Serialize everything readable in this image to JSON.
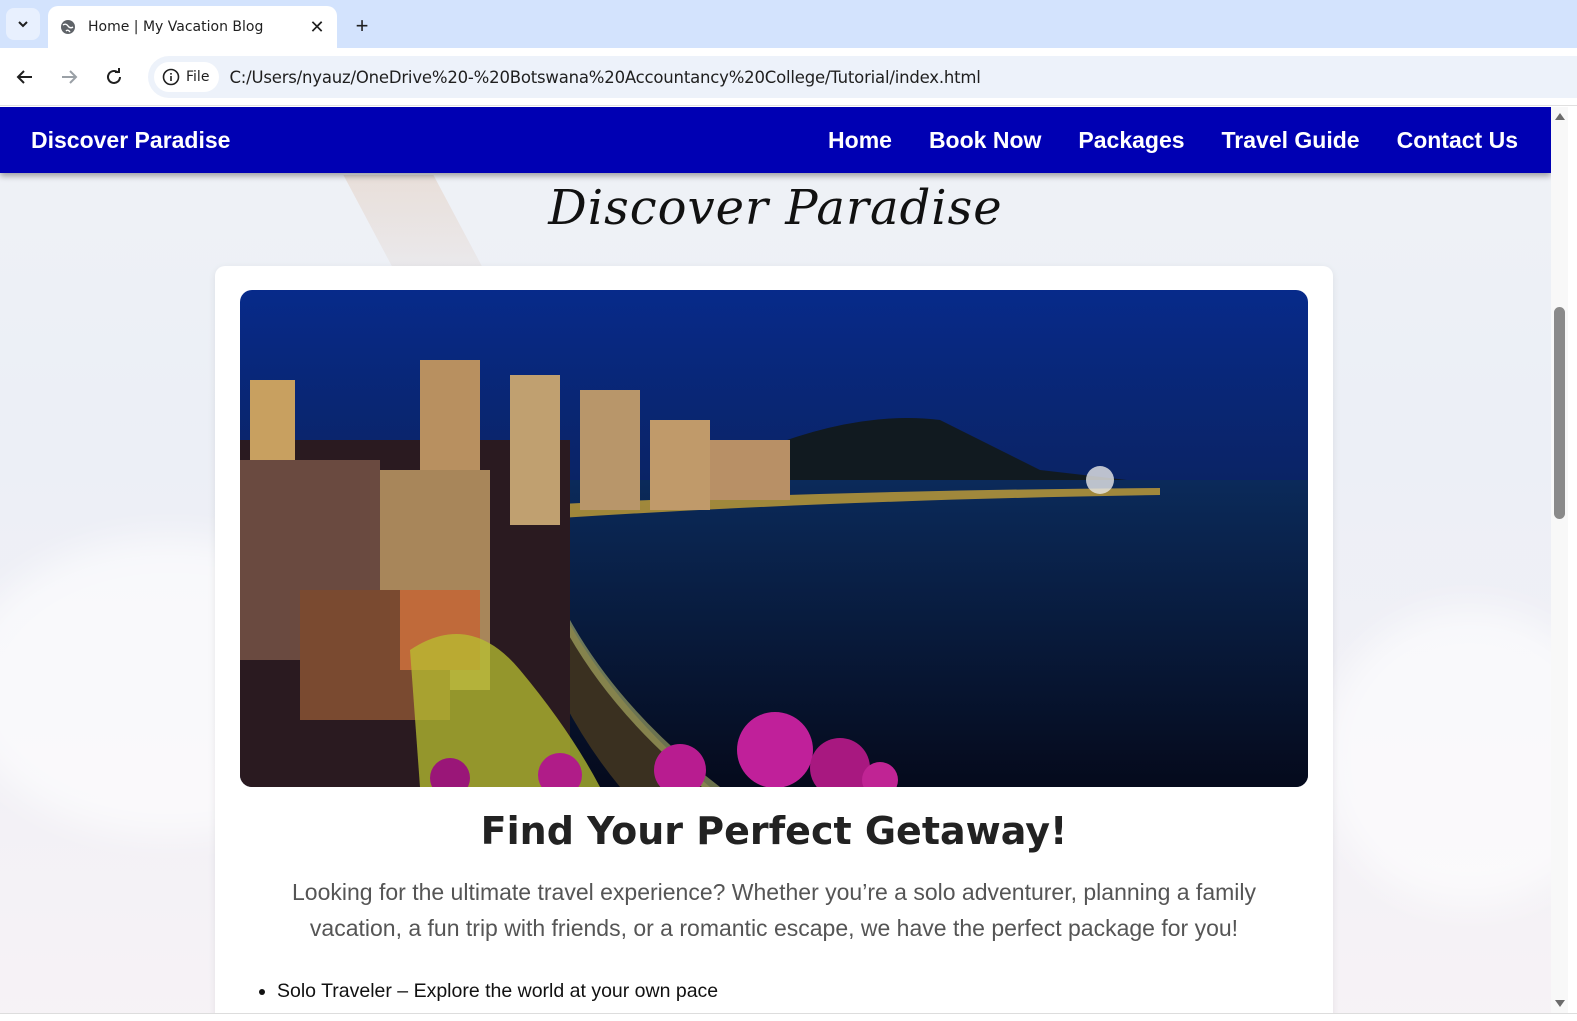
{
  "browser": {
    "tab_title": "Home | My Vacation Blog",
    "new_tab_symbol": "+",
    "close_symbol": "✕",
    "chip_label": "File",
    "url": "C:/Users/nyauz/OneDrive%20-%20Botswana%20Accountancy%20College/Tutorial/index.html"
  },
  "navbar": {
    "brand": "Discover Paradise",
    "links": [
      "Home",
      "Book Now",
      "Packages",
      "Travel Guide",
      "Contact Us"
    ],
    "background": "#0000b3"
  },
  "page": {
    "title": "Discover Paradise",
    "hero_alt": "Night view of a coastal city skyline along a bay with a mountain and pink flowers in the foreground",
    "heading": "Find Your Perfect Getaway!",
    "intro": "Looking for the ultimate travel experience? Whether you’re a solo adventurer, planning a family vacation, a fun trip with friends, or a romantic escape, we have the perfect package for you!",
    "list": [
      "Solo Traveler – Explore the world at your own pace"
    ]
  },
  "icons": {
    "tab_list": "chevron-down-icon",
    "favicon": "globe-icon",
    "back": "back-arrow-icon",
    "forward": "forward-arrow-icon",
    "reload": "reload-icon",
    "info": "info-icon"
  }
}
